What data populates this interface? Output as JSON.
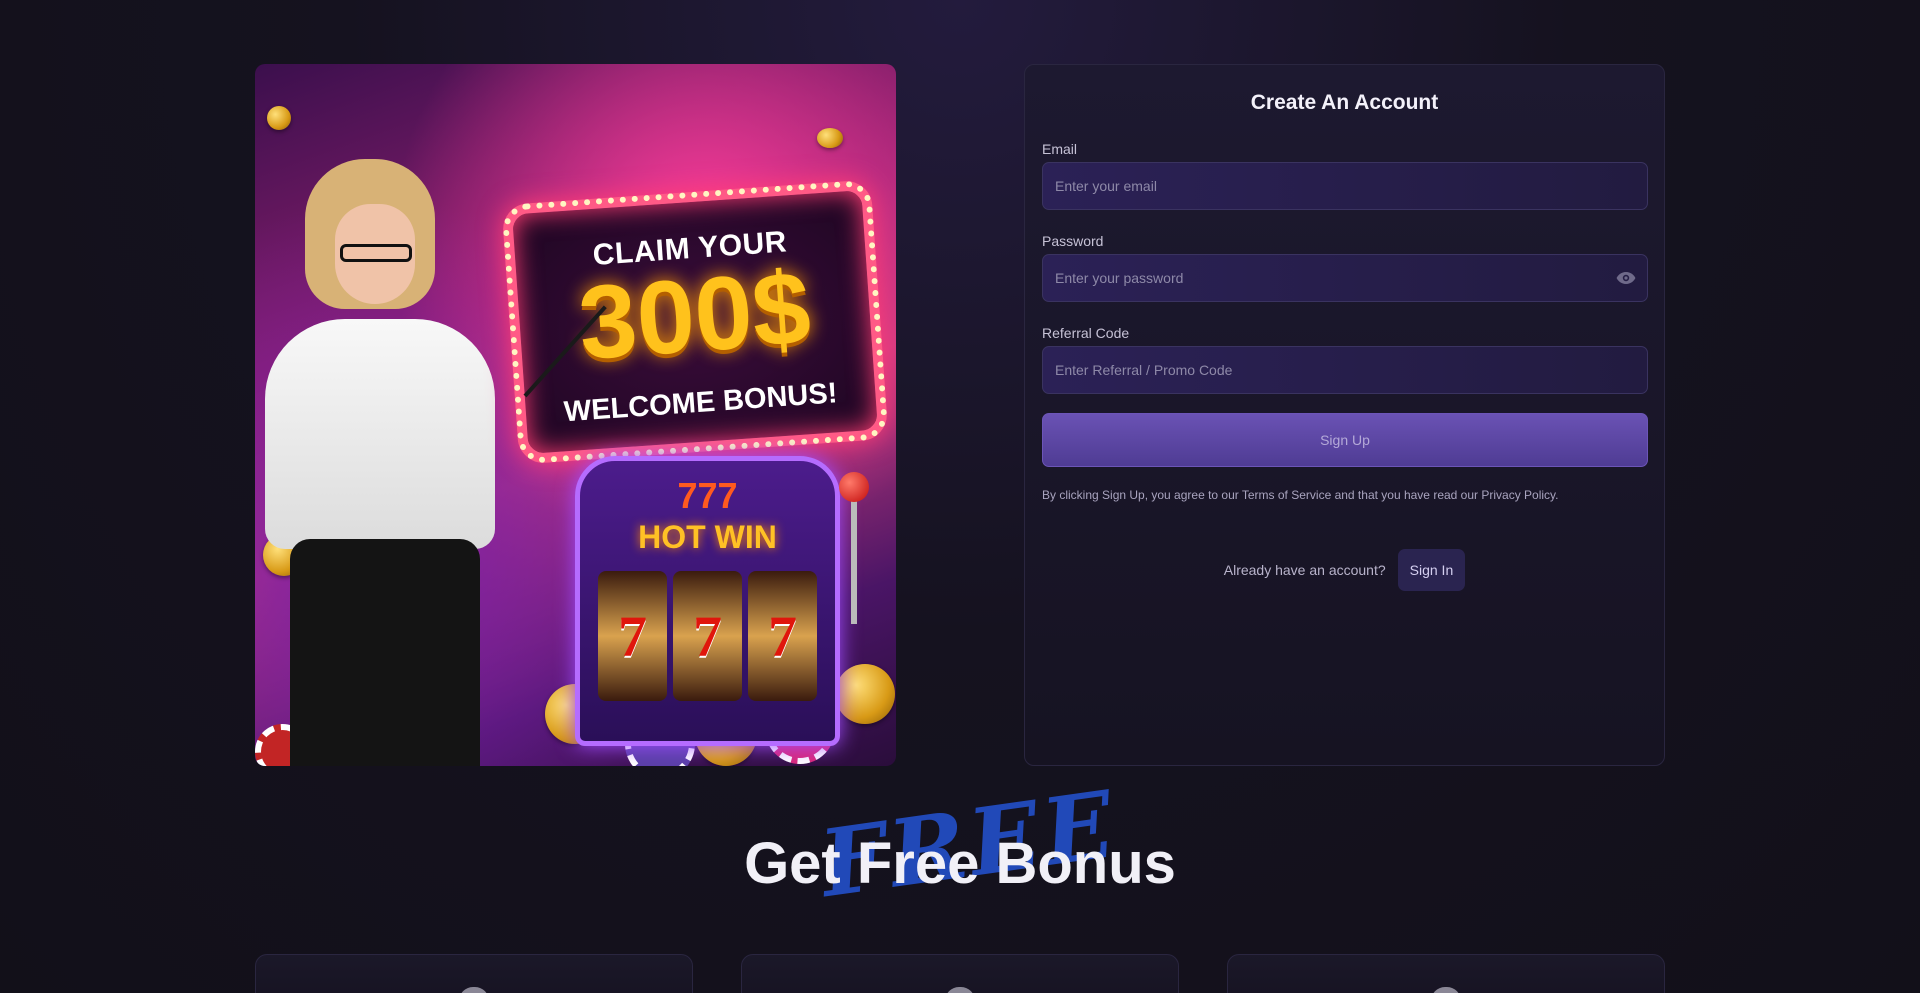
{
  "promo": {
    "headline": "CLAIM YOUR",
    "amount": "300$",
    "subline": "WELCOME BONUS!",
    "slot_top": "777",
    "slot_title": "HOT WIN",
    "reels": [
      "7",
      "7",
      "7"
    ]
  },
  "signup": {
    "title": "Create An Account",
    "email_label": "Email",
    "email_placeholder": "Enter your email",
    "password_label": "Password",
    "password_placeholder": "Enter your password",
    "referral_label": "Referral Code",
    "referral_placeholder": "Enter Referral / Promo Code",
    "submit_label": "Sign Up",
    "terms_text": "By clicking Sign Up, you agree to our Terms of Service and that you have read our Privacy Policy.",
    "have_account_text": "Already have an account?",
    "signin_label": "Sign In"
  },
  "bonus": {
    "script_word": "FREE",
    "title": "Get Free Bonus"
  },
  "colors": {
    "accent": "#5b46a6",
    "background": "#15121f",
    "script_blue": "#2149b8"
  },
  "icons": {
    "password_toggle": "eye-icon"
  }
}
